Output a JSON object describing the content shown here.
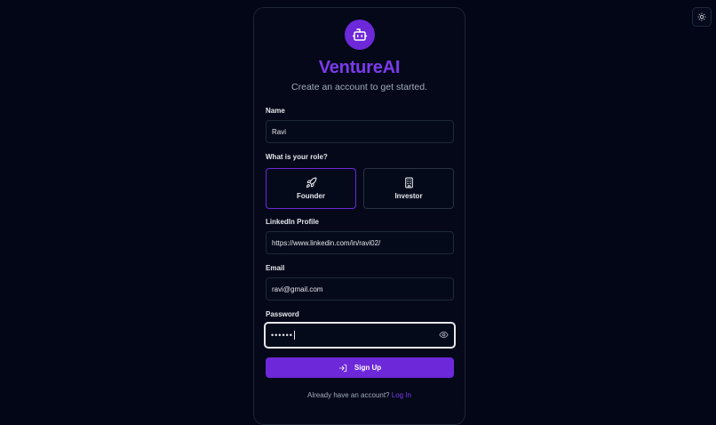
{
  "brand": {
    "title": "VentureAI",
    "subtitle": "Create an account to get started.",
    "logo_icon": "robot-icon",
    "accent": "#6d28d9"
  },
  "theme_toggle": {
    "icon": "sun-icon"
  },
  "form": {
    "name": {
      "label": "Name",
      "value": "Ravi"
    },
    "role": {
      "label": "What is your role?",
      "options": [
        {
          "label": "Founder",
          "icon": "rocket-icon",
          "selected": true
        },
        {
          "label": "Investor",
          "icon": "building-icon",
          "selected": false
        }
      ]
    },
    "linkedin": {
      "label": "LinkedIn Profile",
      "value": "https://www.linkedin.com/in/ravi02/"
    },
    "email": {
      "label": "Email",
      "value": "ravi@gmail.com"
    },
    "password": {
      "label": "Password",
      "masked_value": "••••••",
      "toggle_icon": "eye-icon"
    },
    "submit": {
      "label": "Sign Up",
      "icon": "log-in-icon"
    }
  },
  "footer": {
    "prompt": "Already have an account?",
    "link": "Log In"
  }
}
